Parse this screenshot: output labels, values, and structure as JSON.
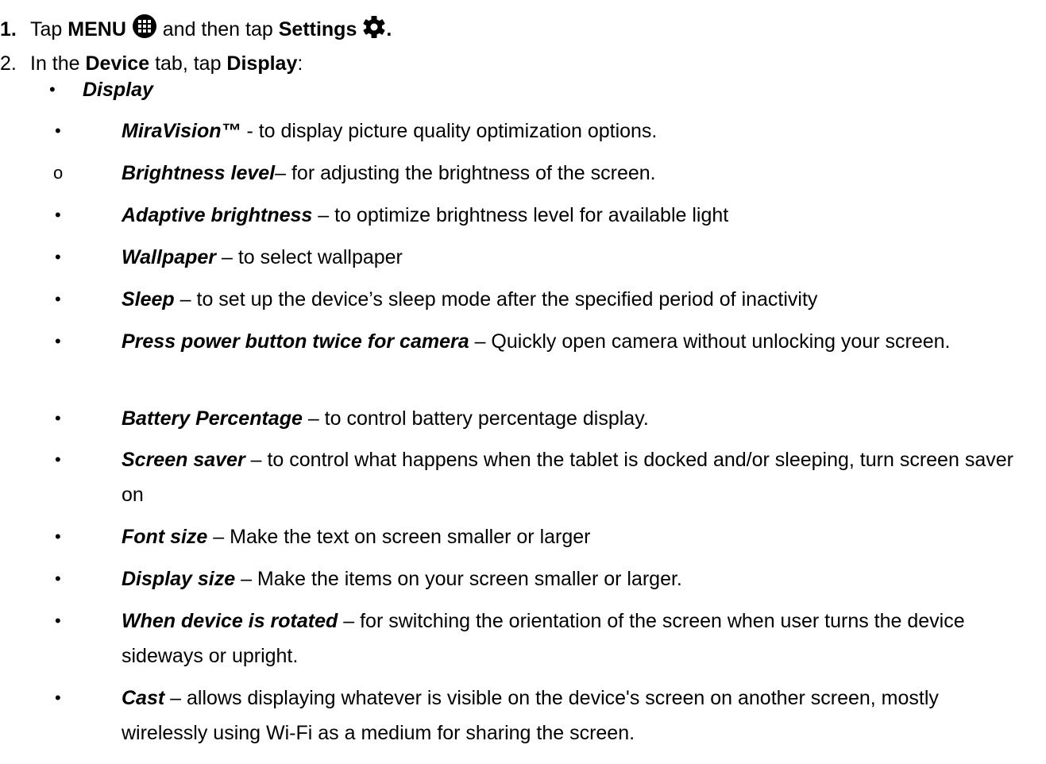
{
  "steps": [
    {
      "number": "1.",
      "pre": "Tap ",
      "menu": "MENU",
      "mid": " and then tap ",
      "settings": "Settings",
      "end": "."
    },
    {
      "number": "2.",
      "pre": "In the ",
      "device": "Device",
      "mid": " tab, tap ",
      "display": "Display",
      "end": ":"
    }
  ],
  "section_title": "Display",
  "items": [
    {
      "term": "MiraVision™",
      "desc": " - to display picture quality optimization options.",
      "marker": "•"
    },
    {
      "term": "Brightness level",
      "desc": "– for adjusting the brightness of the screen.",
      "marker": "o"
    },
    {
      "term": "Adaptive brightness",
      "desc": " – to optimize brightness level for available light",
      "marker": "•"
    },
    {
      "term": "Wallpaper",
      "desc": " – to select wallpaper",
      "marker": "•"
    },
    {
      "term": "Sleep",
      "desc": " – to set up the device’s sleep mode after the specified period of inactivity",
      "marker": "•"
    },
    {
      "term": "Press power button twice for camera",
      "desc": " – Quickly open camera without unlocking your screen.",
      "marker": "•"
    },
    {
      "term": "Battery Percentage",
      "desc": " – to control battery percentage display.",
      "marker": "•"
    },
    {
      "term": "Screen saver",
      "desc": " – to control what happens when the tablet is docked and/or sleeping, turn screen saver on",
      "marker": "•"
    },
    {
      "term": "Font size",
      "desc": " – Make the text on screen smaller or larger",
      "marker": "•"
    },
    {
      "term": "Display size",
      "desc": " – Make the items on your screen smaller or larger.",
      "marker": "•"
    },
    {
      "term": "When device is rotated",
      "desc": " – for switching the orientation of the screen when user turns the device sideways or upright.",
      "marker": "•"
    },
    {
      "term": "Cast",
      "desc": " – allows displaying whatever is visible on the device's screen on another screen, mostly wirelessly using Wi-Fi as a medium for sharing the screen.",
      "marker": "•"
    }
  ],
  "icons": [
    "grid-menu-icon",
    "gear-icon"
  ]
}
